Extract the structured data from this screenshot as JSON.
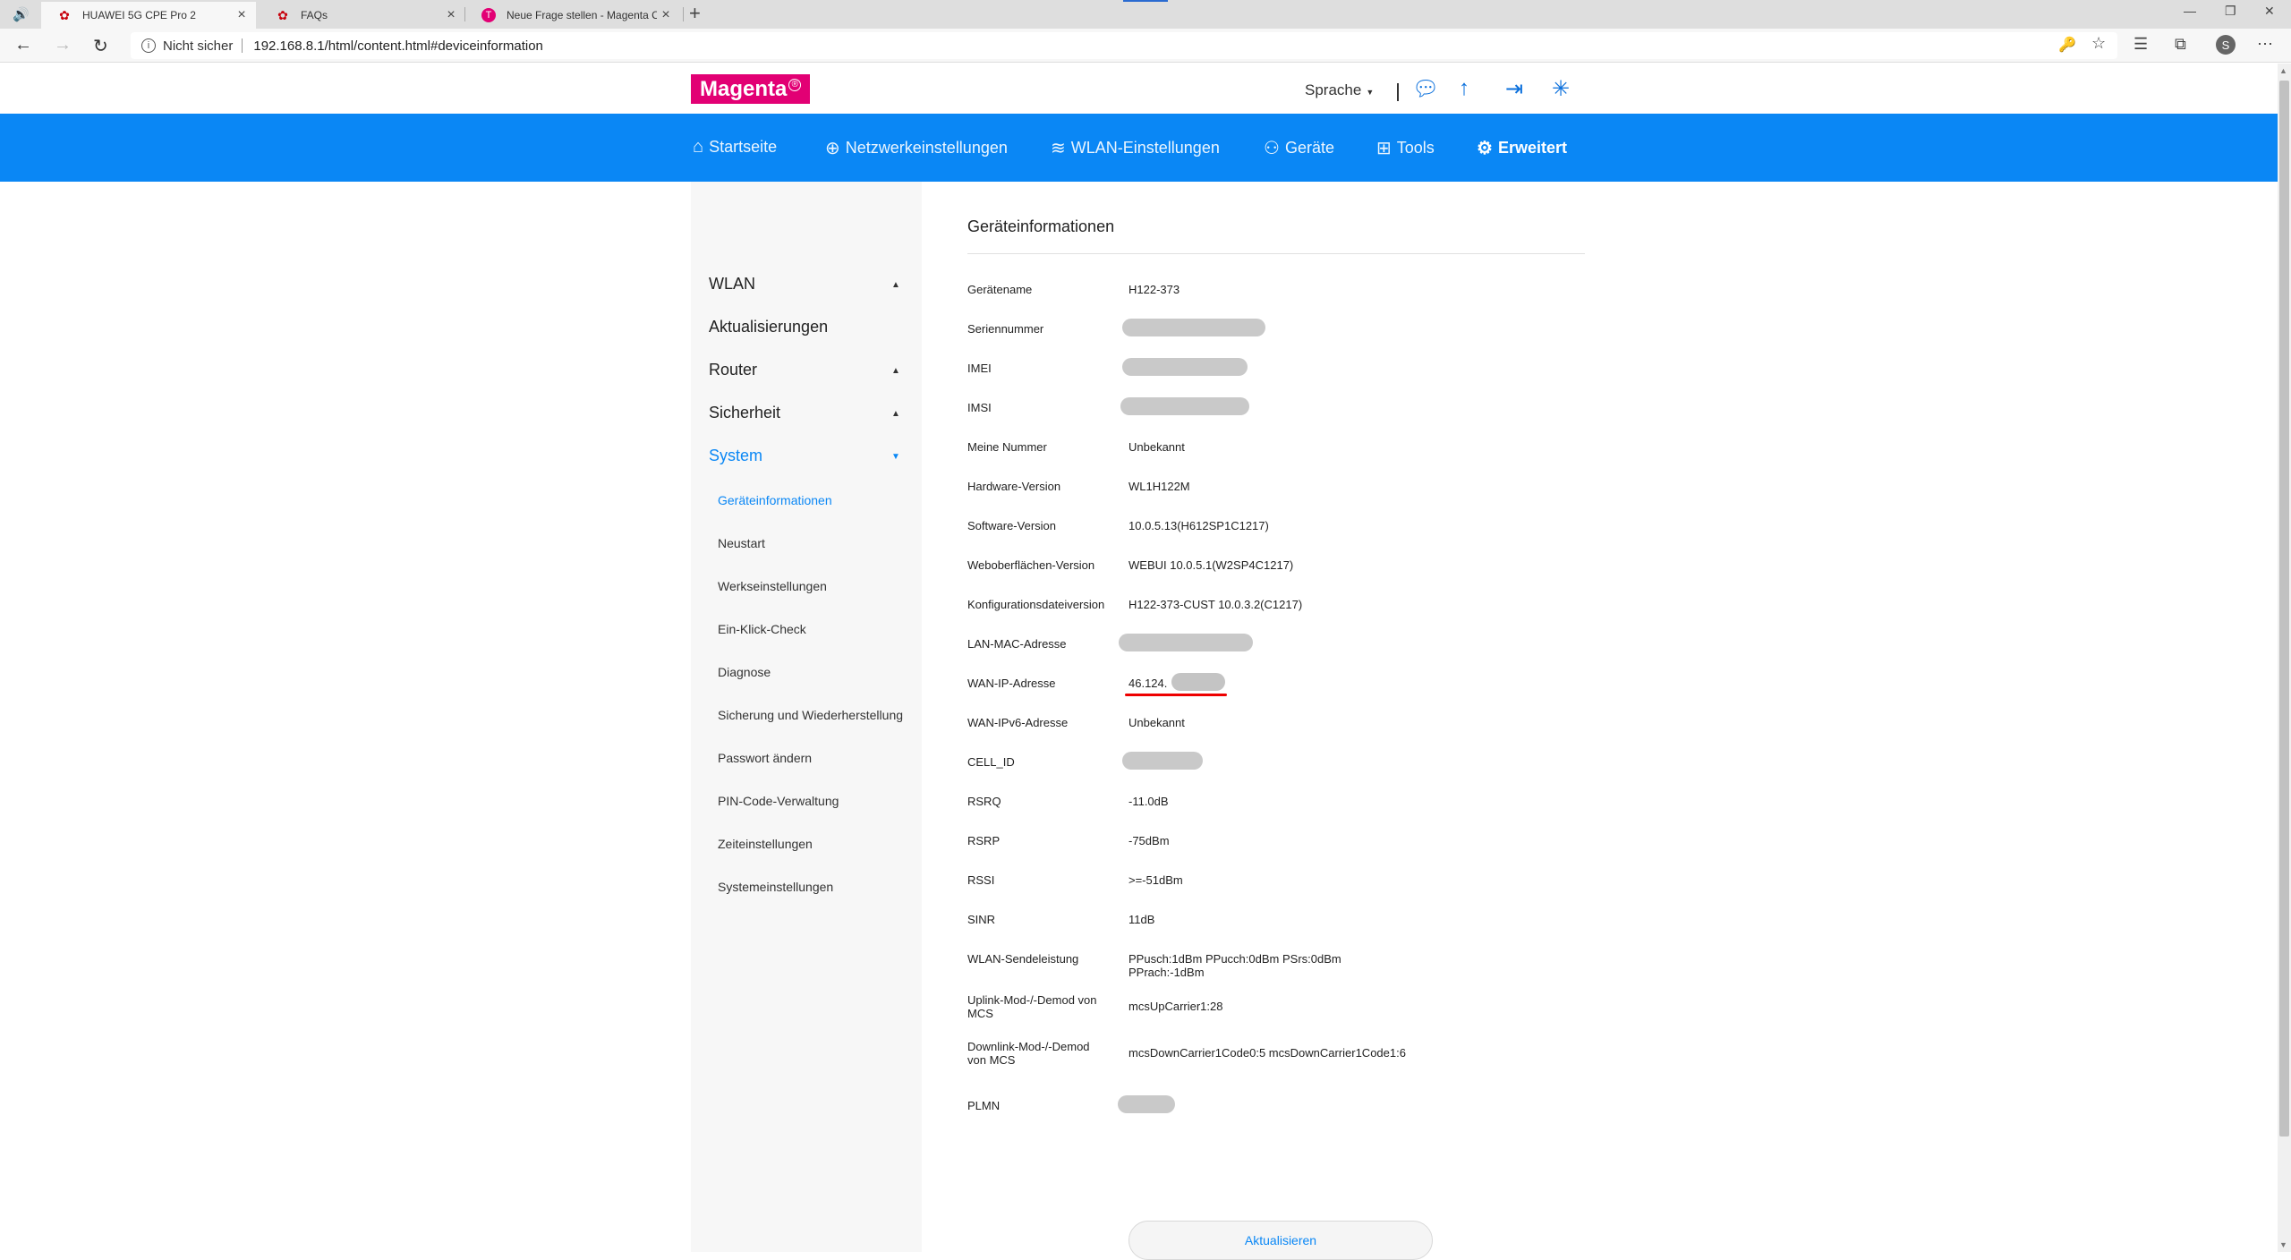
{
  "browser": {
    "tabs": [
      {
        "label": "HUAWEI 5G CPE Pro 2",
        "favicon": "huawei-icon",
        "active": true
      },
      {
        "label": "FAQs",
        "favicon": "huawei-icon",
        "active": false
      },
      {
        "label": "Neue Frage stellen - Magenta Co",
        "favicon": "telekom-icon",
        "active": false
      }
    ],
    "insecure_label": "Nicht sicher",
    "url": "192.168.8.1/html/content.html#deviceinformation",
    "profile_initial": "S"
  },
  "header": {
    "logo_text": "Magenta",
    "logo_mark": "®",
    "language_label": "Sprache",
    "brand_color": "#e20074",
    "accent_color": "#0a87f5"
  },
  "nav": {
    "items": [
      {
        "label": "Startseite",
        "icon": "home-icon"
      },
      {
        "label": "Netzwerkeinstellungen",
        "icon": "globe-icon"
      },
      {
        "label": "WLAN-Einstellungen",
        "icon": "wifi-icon"
      },
      {
        "label": "Geräte",
        "icon": "devices-icon"
      },
      {
        "label": "Tools",
        "icon": "tools-icon"
      },
      {
        "label": "Erweitert",
        "icon": "gear-icon",
        "active": true
      }
    ]
  },
  "sidebar": {
    "sections": [
      {
        "label": "WLAN",
        "expanded": false
      },
      {
        "label": "Aktualisierungen"
      },
      {
        "label": "Router",
        "expanded": false
      },
      {
        "label": "Sicherheit",
        "expanded": false
      },
      {
        "label": "System",
        "expanded": true,
        "active": true
      }
    ],
    "sub_items": [
      {
        "label": "Geräteinformationen",
        "active": true
      },
      {
        "label": "Neustart"
      },
      {
        "label": "Werkseinstellungen"
      },
      {
        "label": "Ein-Klick-Check"
      },
      {
        "label": "Diagnose"
      },
      {
        "label": "Sicherung und Wiederherstellung"
      },
      {
        "label": "Passwort ändern"
      },
      {
        "label": "PIN-Code-Verwaltung"
      },
      {
        "label": "Zeiteinstellungen"
      },
      {
        "label": "Systemeinstellungen"
      }
    ]
  },
  "content": {
    "title": "Geräteinformationen",
    "rows": [
      {
        "label": "Gerätename",
        "value": "H122-373"
      },
      {
        "label": "Seriennummer",
        "value": "",
        "redacted": true
      },
      {
        "label": "IMEI",
        "value": "",
        "redacted": true
      },
      {
        "label": "IMSI",
        "value": "",
        "redacted": true
      },
      {
        "label": "Meine Nummer",
        "value": "Unbekannt"
      },
      {
        "label": "Hardware-Version",
        "value": "WL1H122M"
      },
      {
        "label": "Software-Version",
        "value": "10.0.5.13(H612SP1C1217)"
      },
      {
        "label": "Weboberflächen-Version",
        "value": "WEBUI 10.0.5.1(W2SP4C1217)"
      },
      {
        "label": "Konfigurationsdateiversion",
        "value": "H122-373-CUST 10.0.3.2(C1217)"
      },
      {
        "label": "LAN-MAC-Adresse",
        "value": "",
        "redacted": true
      },
      {
        "label": "WAN-IP-Adresse",
        "value": "46.124.",
        "partially_redacted": true
      },
      {
        "label": "WAN-IPv6-Adresse",
        "value": "Unbekannt"
      },
      {
        "label": "CELL_ID",
        "value": "",
        "redacted": true
      },
      {
        "label": "RSRQ",
        "value": "-11.0dB"
      },
      {
        "label": "RSRP",
        "value": "-75dBm"
      },
      {
        "label": "RSSI",
        "value": ">=-51dBm"
      },
      {
        "label": "SINR",
        "value": "11dB"
      },
      {
        "label": "WLAN-Sendeleistung",
        "value": "PPusch:1dBm PPucch:0dBm PSrs:0dBm",
        "value2": "PPrach:-1dBm"
      },
      {
        "label": "Uplink-Mod-/-Demod von",
        "label2": "MCS",
        "value": "mcsUpCarrier1:28"
      },
      {
        "label": "Downlink-Mod-/-Demod",
        "label2": "von MCS",
        "value": "mcsDownCarrier1Code0:5 mcsDownCarrier1Code1:6"
      },
      {
        "label": "PLMN",
        "value": "",
        "redacted": true
      }
    ],
    "refresh_button": "Aktualisieren"
  }
}
